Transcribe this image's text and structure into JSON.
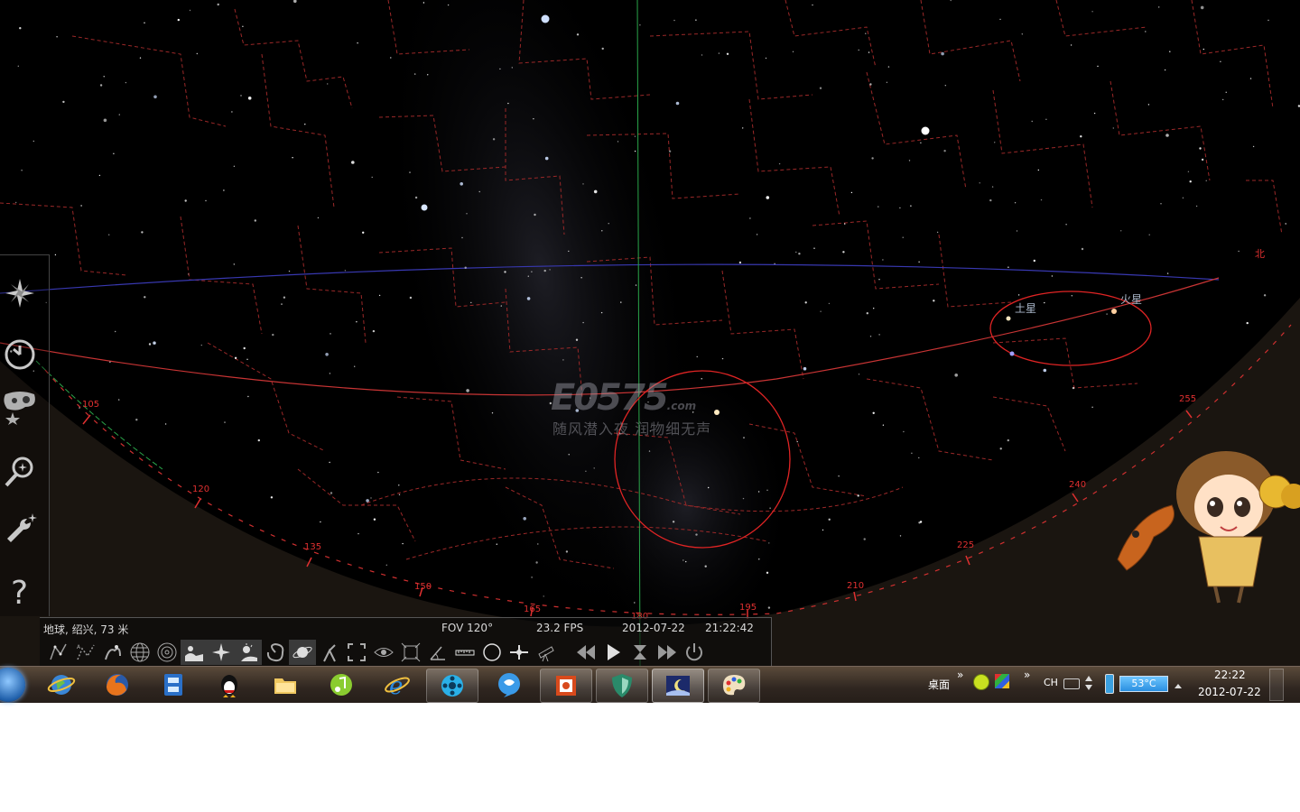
{
  "sky": {
    "planets": [
      {
        "label": "土星"
      },
      {
        "label": "火星"
      }
    ],
    "azimuth_labels": [
      "105",
      "120",
      "135",
      "150",
      "165",
      "180",
      "195",
      "210",
      "225",
      "240",
      "255"
    ],
    "horizon_marker": "北",
    "watermark": {
      "logo": "E0575",
      "suffix": ".com",
      "slogan": "随风潜入夜 润物细无声"
    }
  },
  "left_toolbar": {
    "items": [
      {
        "name": "location-window",
        "icon": "compass-star-icon"
      },
      {
        "name": "date-time-window",
        "icon": "clock-icon"
      },
      {
        "name": "sky-view-options",
        "icon": "sky-options-icon"
      },
      {
        "name": "search-window",
        "icon": "search-icon"
      },
      {
        "name": "configuration-window",
        "icon": "wrench-icon"
      },
      {
        "name": "help-window",
        "icon": "help-icon"
      }
    ]
  },
  "bottom_bar": {
    "location": "地球, 绍兴, 73 米",
    "fov": "FOV 120°",
    "fps": "23.2 FPS",
    "date": "2012-07-22",
    "time": "21:22:42",
    "tools": [
      {
        "name": "constellation-lines",
        "icon": "constellation-lines-icon"
      },
      {
        "name": "constellation-labels",
        "icon": "constellation-labels-icon"
      },
      {
        "name": "constellation-art",
        "icon": "constellation-art-icon"
      },
      {
        "name": "equatorial-grid",
        "icon": "equatorial-grid-icon"
      },
      {
        "name": "azimuthal-grid",
        "icon": "azimuthal-grid-icon"
      },
      {
        "name": "ground",
        "icon": "ground-icon"
      },
      {
        "name": "cardinal-points",
        "icon": "cardinal-points-icon"
      },
      {
        "name": "atmosphere",
        "icon": "atmosphere-icon"
      },
      {
        "name": "nebulae",
        "icon": "nebula-icon"
      },
      {
        "name": "planet-labels",
        "icon": "planet-icon"
      },
      {
        "name": "equatorial-mount",
        "icon": "mount-icon"
      },
      {
        "name": "center-selected",
        "icon": "center-icon"
      },
      {
        "name": "night-mode",
        "icon": "eye-icon"
      },
      {
        "name": "full-screen",
        "icon": "fullscreen-icon"
      },
      {
        "name": "angle-measure",
        "icon": "angle-icon"
      },
      {
        "name": "ruler",
        "icon": "ruler-icon"
      },
      {
        "name": "ocular",
        "icon": "circle-icon"
      },
      {
        "name": "crosshair",
        "icon": "crosshair-icon"
      },
      {
        "name": "telescope",
        "icon": "telescope-icon"
      },
      {
        "name": "decrease-time-speed",
        "icon": "rewind-icon"
      },
      {
        "name": "play",
        "icon": "play-icon"
      },
      {
        "name": "set-normal-time",
        "icon": "hourglass-icon"
      },
      {
        "name": "increase-time-speed",
        "icon": "fast-forward-icon"
      },
      {
        "name": "quit",
        "icon": "power-icon"
      }
    ]
  },
  "taskbar": {
    "apps": [
      {
        "name": "ie-globe",
        "icon": "globe-icon",
        "state": "pinned"
      },
      {
        "name": "firefox",
        "icon": "firefox-icon",
        "state": "pinned"
      },
      {
        "name": "media-center",
        "icon": "film-icon",
        "state": "pinned"
      },
      {
        "name": "qq",
        "icon": "penguin-icon",
        "state": "pinned"
      },
      {
        "name": "explorer",
        "icon": "folder-icon",
        "state": "pinned"
      },
      {
        "name": "music-player",
        "icon": "music-icon",
        "state": "pinned"
      },
      {
        "name": "internet-explorer",
        "icon": "ie-icon",
        "state": "pinned"
      },
      {
        "name": "video-player",
        "icon": "film-reel-icon",
        "state": "open"
      },
      {
        "name": "messenger",
        "icon": "chat-bubble-icon",
        "state": "pinned"
      },
      {
        "name": "powerpoint",
        "icon": "presentation-icon",
        "state": "open"
      },
      {
        "name": "security-shield",
        "icon": "shield-icon",
        "state": "open"
      },
      {
        "name": "stellarium",
        "icon": "moon-night-icon",
        "state": "active"
      },
      {
        "name": "paint",
        "icon": "palette-icon",
        "state": "open"
      }
    ],
    "desktop_label": "桌面",
    "expand_arrow": "»",
    "language": "CH",
    "temperature": "53°C",
    "clock_time": "22:22",
    "clock_date": "2012-07-22"
  },
  "colors": {
    "sky": "#000000",
    "constellation_boundary": "#a02828",
    "ecliptic": "#c83030",
    "equator": "#3030a0",
    "meridian": "#20a040"
  }
}
